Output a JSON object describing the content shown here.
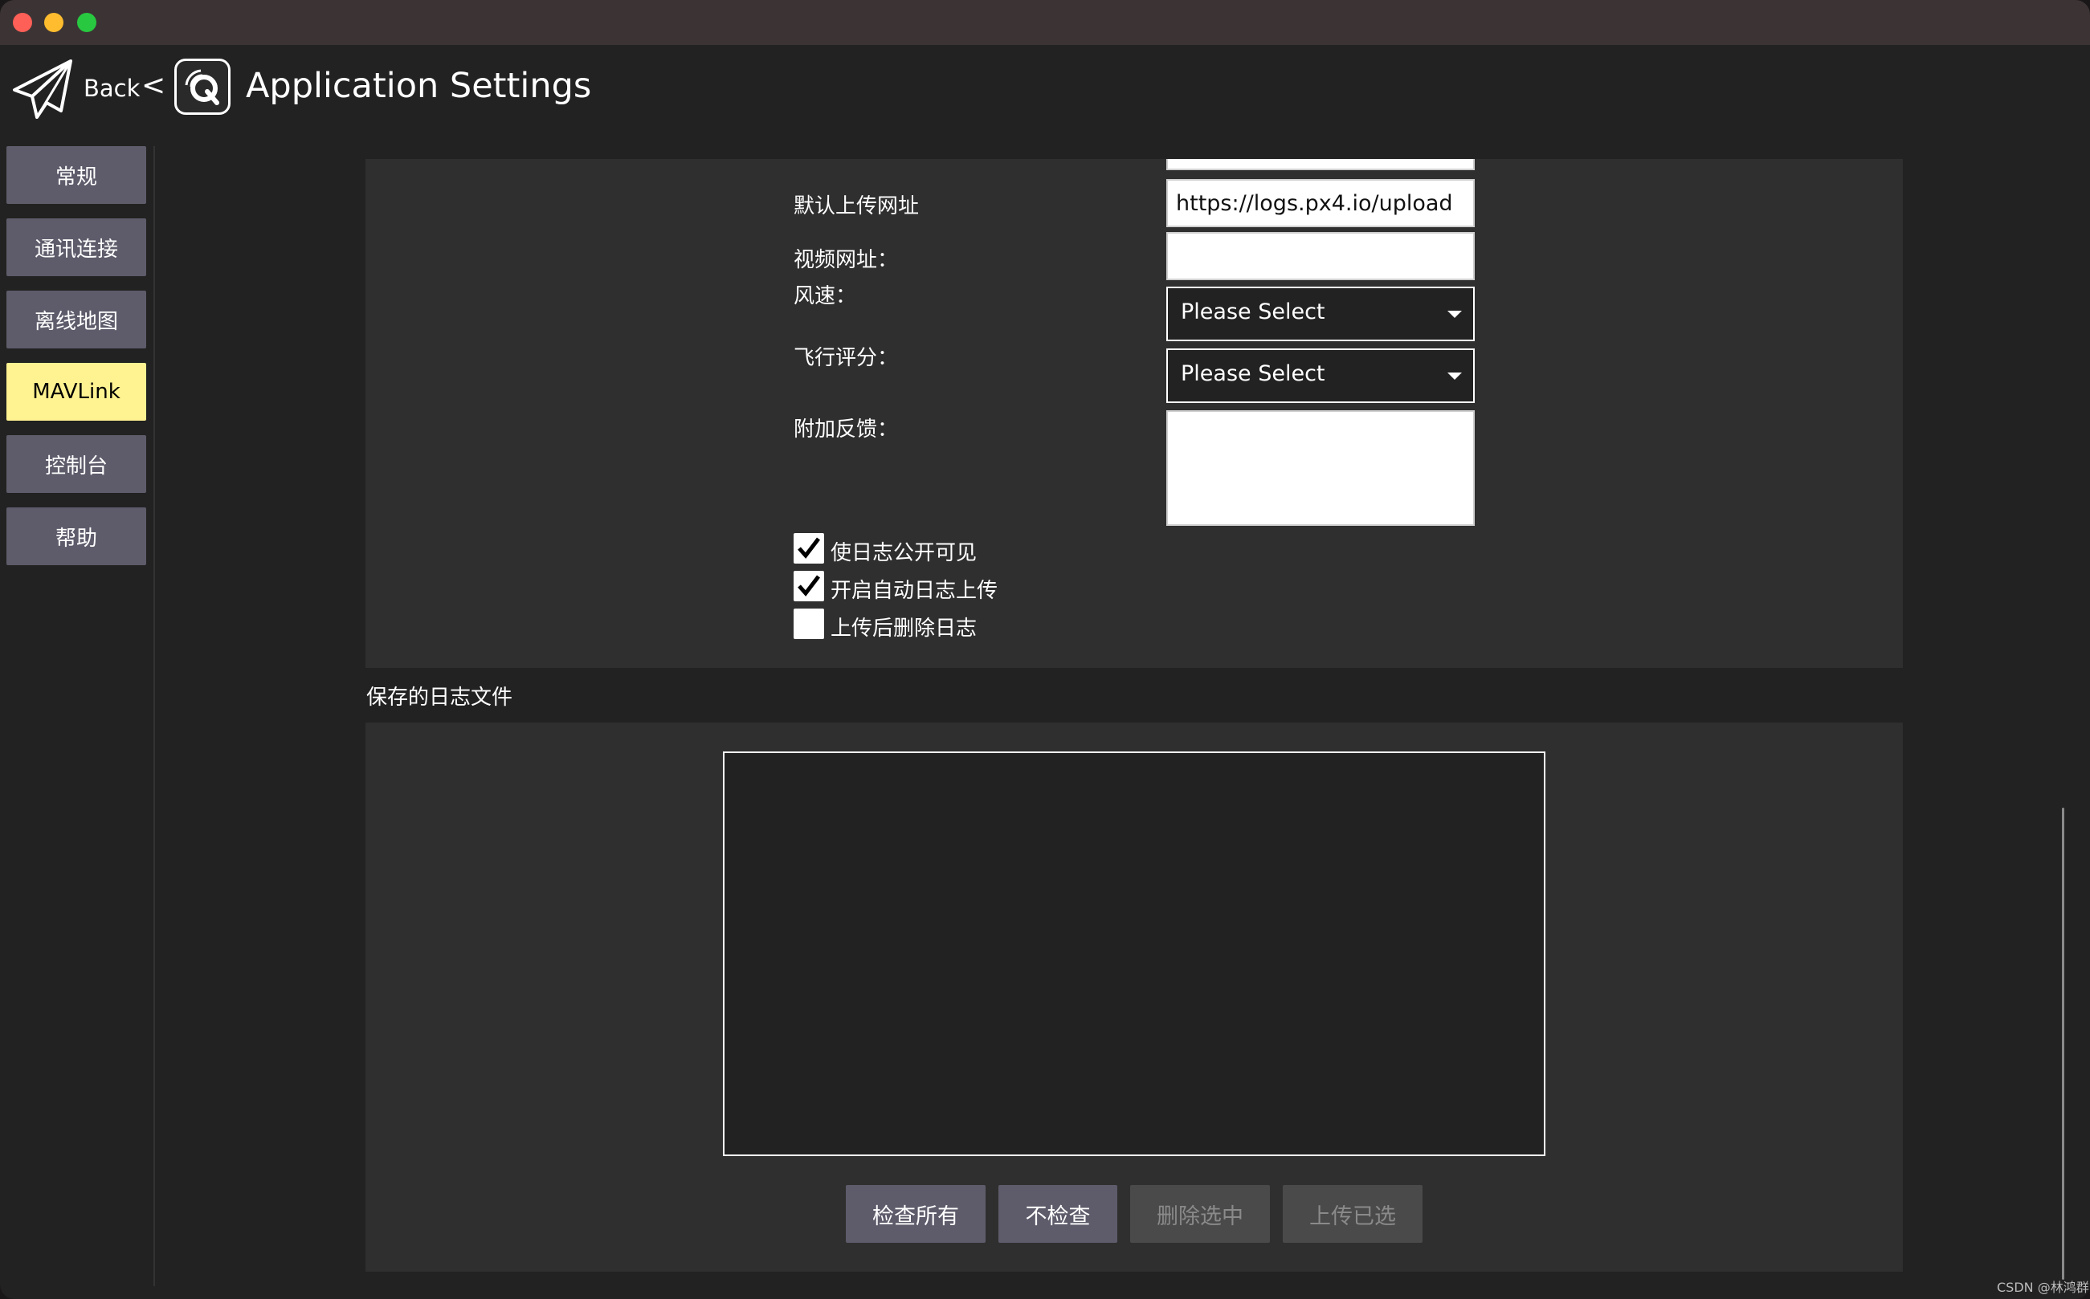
{
  "window": {
    "traffic_lights": [
      "close",
      "minimize",
      "zoom"
    ],
    "colors": {
      "close": "#fe5f57",
      "minimize": "#febc2e",
      "zoom": "#28c840"
    }
  },
  "header": {
    "back_label": "Back",
    "back_chevron": "<",
    "title": "Application Settings",
    "icons": [
      "paper-plane-icon",
      "qgc-logo-icon"
    ]
  },
  "sidebar": {
    "items": [
      {
        "label": "常规",
        "active": false
      },
      {
        "label": "通讯连接",
        "active": false
      },
      {
        "label": "离线地图",
        "active": false
      },
      {
        "label": "MAVLink",
        "active": true
      },
      {
        "label": "控制台",
        "active": false
      },
      {
        "label": "帮助",
        "active": false
      }
    ],
    "active_color": "#fff291",
    "item_color": "#5e5c6b"
  },
  "form": {
    "upload_url": {
      "label": "默认上传网址",
      "value": "https://logs.px4.io/upload"
    },
    "video_url": {
      "label": "视频网址：",
      "value": ""
    },
    "wind_speed": {
      "label": "风速：",
      "value": "Please Select"
    },
    "flight_rating": {
      "label": "飞行评分：",
      "value": "Please Select"
    },
    "feedback": {
      "label": "附加反馈：",
      "value": ""
    },
    "checkboxes": [
      {
        "label": "使日志公开可见",
        "checked": true
      },
      {
        "label": "开启自动日志上传",
        "checked": true
      },
      {
        "label": "上传后删除日志",
        "checked": false
      }
    ]
  },
  "saved_logs": {
    "title": "保存的日志文件",
    "files": [],
    "buttons": [
      {
        "label": "检查所有",
        "enabled": true
      },
      {
        "label": "不检查",
        "enabled": true
      },
      {
        "label": "删除选中",
        "enabled": false
      },
      {
        "label": "上传已选",
        "enabled": false
      }
    ]
  },
  "watermark": "CSDN @林鸿群"
}
